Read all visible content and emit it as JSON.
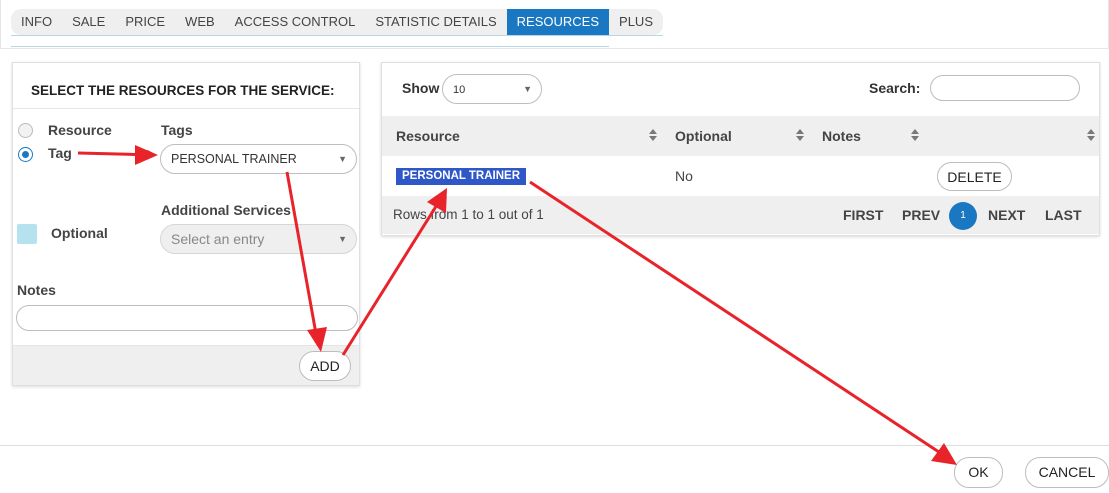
{
  "tabs": [
    {
      "label": "INFO",
      "active": false
    },
    {
      "label": "SALE",
      "active": false
    },
    {
      "label": "PRICE",
      "active": false
    },
    {
      "label": "WEB",
      "active": false
    },
    {
      "label": "ACCESS CONTROL",
      "active": false
    },
    {
      "label": "STATISTIC DETAILS",
      "active": false
    },
    {
      "label": "RESOURCES",
      "active": true
    },
    {
      "label": "PLUS",
      "active": false
    }
  ],
  "left_panel": {
    "title": "SELECT THE RESOURCES FOR THE SERVICE:",
    "radio_resource_label": "Resource",
    "radio_tag_label": "Tag",
    "selected_radio": "Tag",
    "tags_label": "Tags",
    "tags_value": "PERSONAL TRAINER",
    "optional_label": "Optional",
    "additional_services_label": "Additional Services",
    "additional_services_placeholder": "Select an entry",
    "notes_label": "Notes",
    "notes_value": "",
    "add_button": "ADD"
  },
  "table": {
    "show_label": "Show",
    "show_value": "10",
    "search_label": "Search:",
    "search_value": "",
    "columns": [
      "Resource",
      "Optional",
      "Notes",
      ""
    ],
    "rows": [
      {
        "resource": "PERSONAL TRAINER",
        "optional": "No",
        "notes": "",
        "action": "DELETE"
      }
    ],
    "rows_info": "Rows from 1 to 1 out of 1",
    "pagination": {
      "first": "FIRST",
      "prev": "PREV",
      "current": "1",
      "next": "NEXT",
      "last": "LAST"
    }
  },
  "footer": {
    "ok": "OK",
    "cancel": "CANCEL"
  },
  "colors": {
    "accent": "#1a78c2",
    "badge": "#2f57c8",
    "annotation_arrow": "#e8232a"
  }
}
